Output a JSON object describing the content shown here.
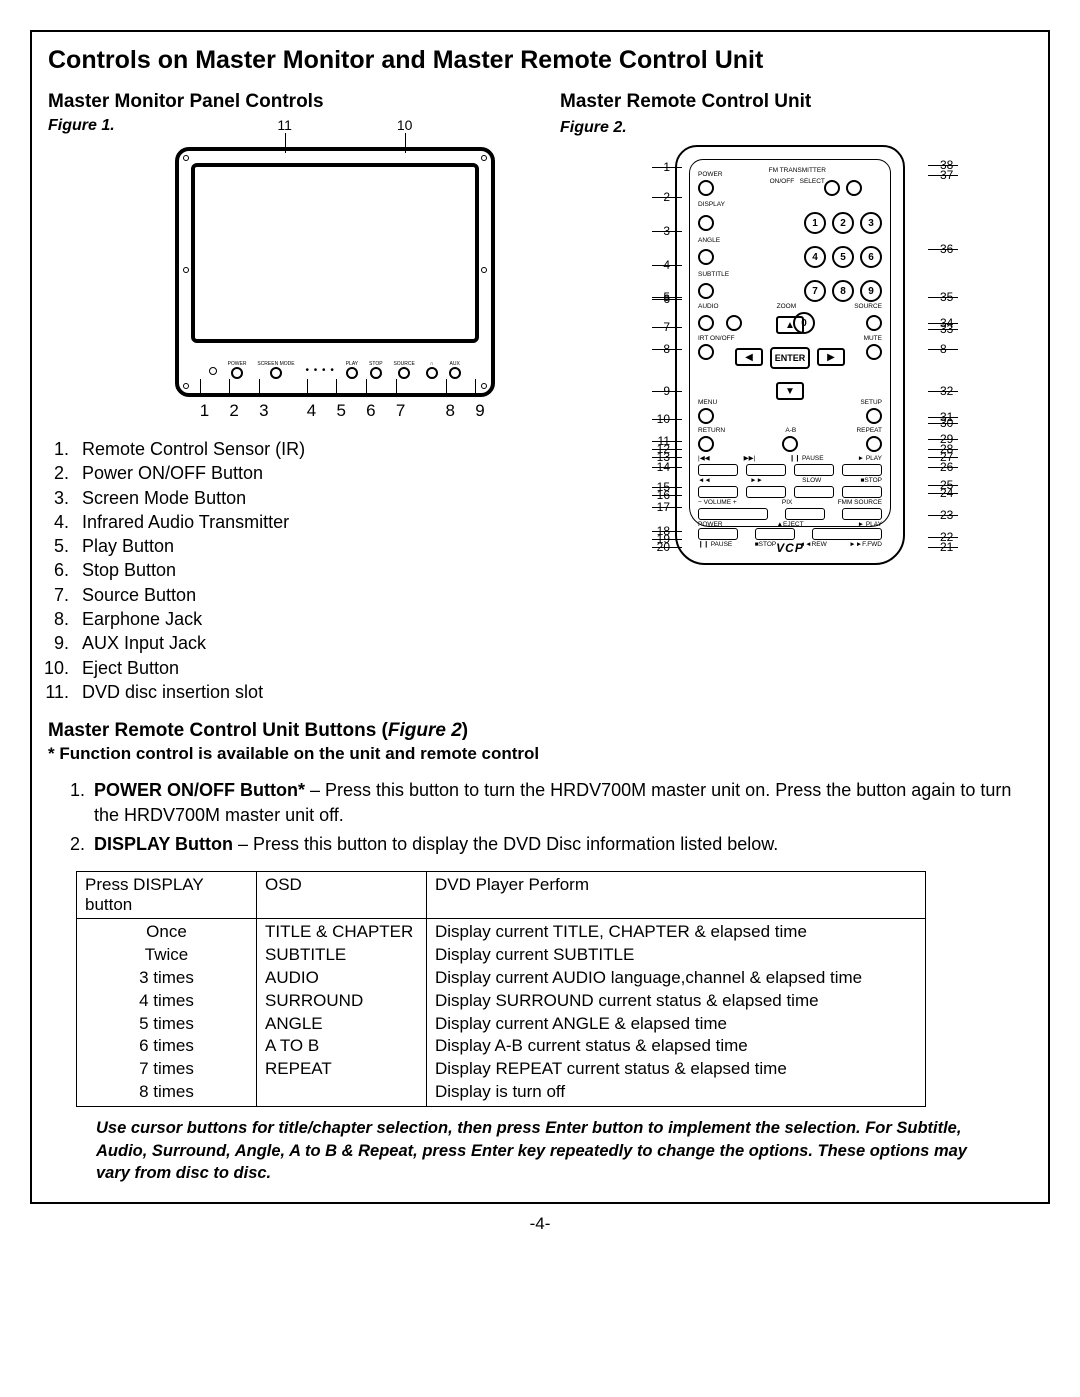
{
  "title": "Controls on Master Monitor and Master Remote Control Unit",
  "left": {
    "heading": "Master Monitor Panel Controls",
    "figure_label": "Figure 1.",
    "top_callouts": [
      "11",
      "10"
    ],
    "bottom_callouts": [
      "1",
      "2",
      "3",
      "4",
      "5",
      "6",
      "7",
      "8",
      "9"
    ],
    "panel_labels": {
      "power": "POWER",
      "screen": "SCREEN MODE",
      "play": "PLAY",
      "stop": "STOP",
      "source": "SOURCE",
      "aux": "AUX"
    },
    "list": [
      "Remote Control Sensor (IR)",
      "Power ON/OFF Button",
      "Screen Mode Button",
      "Infrared Audio Transmitter",
      "Play Button",
      "Stop Button",
      "Source Button",
      "Earphone Jack",
      "AUX Input Jack",
      "Eject Button",
      "DVD disc insertion slot"
    ]
  },
  "right": {
    "heading": "Master Remote Control Unit",
    "figure_label": "Figure 2.",
    "labels": {
      "power": "POWER",
      "fmt": "FM TRANSMITTER",
      "onoff": "ON/OFF",
      "select": "SELECT",
      "display": "DISPLAY",
      "angle": "ANGLE",
      "subtitle": "SUBTITLE",
      "audio": "AUDIO",
      "zoom": "ZOOM",
      "source": "SOURCE",
      "irt": "IRT ON/OFF",
      "mute": "MUTE",
      "enter": "ENTER",
      "menu": "MENU",
      "setup": "SETUP",
      "return": "RETURN",
      "ab": "A-B",
      "repeat": "REPEAT",
      "pause": "❙❙ PAUSE",
      "play": "► PLAY",
      "rev": "◄◄",
      "fwd": "►►",
      "slow": "SLOW",
      "stop": "■STOP",
      "volm": "− VOLUME +",
      "pix": "PIX",
      "fmm": "FMM SOURCE",
      "powerv": "POWER",
      "eject": "▲EJECT",
      "playv": "► PLAY",
      "pausev": "❙❙ PAUSE",
      "stopv": "■STOP",
      "rew": "◄◄REW",
      "ffwd": "►►F.FWD",
      "vcp": "VCP"
    },
    "keypad": [
      "1",
      "2",
      "3",
      "4",
      "5",
      "6",
      "7",
      "8",
      "9",
      "0"
    ],
    "left_callouts": [
      "1",
      "2",
      "3",
      "4",
      "5",
      "6",
      "7",
      "8",
      "9",
      "10",
      "11",
      "12",
      "13",
      "14",
      "15",
      "16",
      "17",
      "18",
      "19",
      "20"
    ],
    "right_callouts": [
      "38",
      "37",
      "36",
      "35",
      "34",
      "33",
      "8",
      "32",
      "31",
      "30",
      "29",
      "28",
      "27",
      "26",
      "25",
      "24",
      "23",
      "22",
      "21"
    ]
  },
  "buttons_section": {
    "heading_prefix": "Master Remote Control Unit Buttons (",
    "heading_fig": "Figure 2",
    "heading_suffix": ")",
    "note": "* Function control is available on the unit and remote control",
    "items": [
      {
        "bold": "POWER ON/OFF Button*",
        "rest": " – Press this button to turn the HRDV700M master unit on. Press the button again to turn the HRDV700M master unit off."
      },
      {
        "bold": "DISPLAY Button",
        "rest": " – Press this button to display the DVD Disc information listed below."
      }
    ]
  },
  "table": {
    "headers": [
      "Press DISPLAY button",
      "OSD",
      "DVD Player Perform"
    ],
    "rows": [
      [
        "Once",
        "TITLE & CHAPTER",
        "Display current TITLE, CHAPTER & elapsed time"
      ],
      [
        "Twice",
        "SUBTITLE",
        "Display current SUBTITLE"
      ],
      [
        "3 times",
        "AUDIO",
        "Display current AUDIO language,channel & elapsed time"
      ],
      [
        "4 times",
        "SURROUND",
        "Display SURROUND current status & elapsed time"
      ],
      [
        "5 times",
        "ANGLE",
        "Display current ANGLE & elapsed time"
      ],
      [
        "6 times",
        "A TO B",
        "Display A-B current status & elapsed time"
      ],
      [
        "7 times",
        "REPEAT",
        "Display REPEAT current status & elapsed time"
      ],
      [
        "8 times",
        "",
        "Display is turn off"
      ]
    ]
  },
  "footnote": "Use cursor buttons for title/chapter selection, then press Enter button to implement the selection. For Subtitle, Audio, Surround, Angle, A to B & Repeat, press Enter key repeatedly to change the options. These options may vary from disc to disc.",
  "page_number": "-4-"
}
